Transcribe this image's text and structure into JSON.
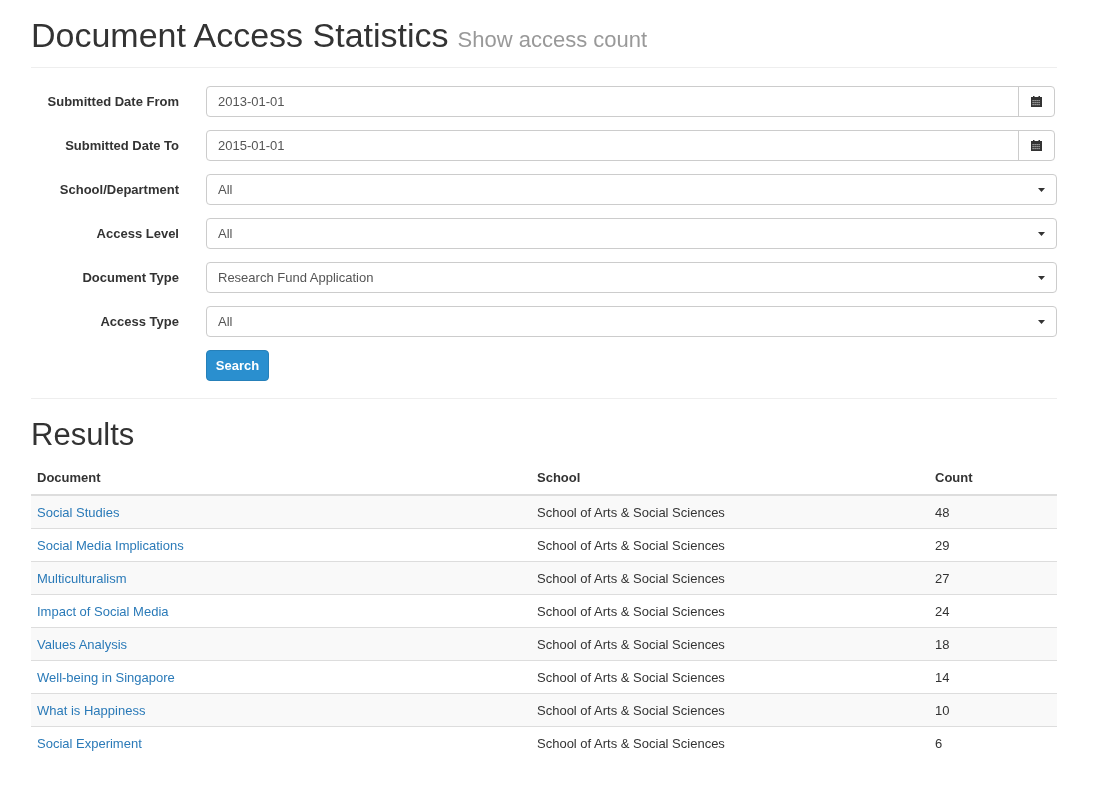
{
  "header": {
    "title": "Document Access Statistics",
    "subtitle": "Show access count"
  },
  "form": {
    "fields": [
      {
        "kind": "date",
        "label": "Submitted Date From",
        "value": "2013-01-01"
      },
      {
        "kind": "date",
        "label": "Submitted Date To",
        "value": "2015-01-01"
      },
      {
        "kind": "select",
        "label": "School/Department",
        "value": "All"
      },
      {
        "kind": "select",
        "label": "Access Level",
        "value": "All"
      },
      {
        "kind": "select",
        "label": "Document Type",
        "value": "Research Fund Application"
      },
      {
        "kind": "select",
        "label": "Access Type",
        "value": "All"
      }
    ],
    "submit": "Search"
  },
  "results": {
    "title": "Results",
    "columns": [
      "Document",
      "School",
      "Count"
    ],
    "rows": [
      {
        "document": "Social Studies",
        "school": "School of Arts & Social Sciences",
        "count": "48"
      },
      {
        "document": "Social Media Implications",
        "school": "School of Arts & Social Sciences",
        "count": "29"
      },
      {
        "document": "Multiculturalism",
        "school": "School of Arts & Social Sciences",
        "count": "27"
      },
      {
        "document": "Impact of Social Media",
        "school": "School of Arts & Social Sciences",
        "count": "24"
      },
      {
        "document": "Values Analysis",
        "school": "School of Arts & Social Sciences",
        "count": "18"
      },
      {
        "document": "Well-being in Singapore",
        "school": "School of Arts & Social Sciences",
        "count": "14"
      },
      {
        "document": "What is Happiness",
        "school": "School of Arts & Social Sciences",
        "count": "10"
      },
      {
        "document": "Social Experiment",
        "school": "School of Arts & Social Sciences",
        "count": "6"
      }
    ]
  }
}
